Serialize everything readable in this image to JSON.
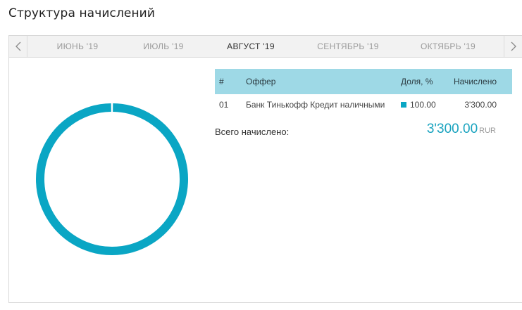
{
  "page": {
    "title": "Структура начислений"
  },
  "months": [
    {
      "label": "ИЮНЬ '19",
      "active": false
    },
    {
      "label": "ИЮЛЬ '19",
      "active": false
    },
    {
      "label": "АВГУСТ '19",
      "active": true
    },
    {
      "label": "СЕНТЯБРЬ '19",
      "active": false
    },
    {
      "label": "ОКТЯБРЬ '19",
      "active": false
    }
  ],
  "nav": {
    "prev_icon": "chevron-left-icon",
    "next_icon": "chevron-right-icon"
  },
  "table": {
    "headers": {
      "num": "#",
      "offer": "Оффер",
      "share": "Доля, %",
      "accrued": "Начислено"
    },
    "rows": [
      {
        "num": "01",
        "offer": "Банк Тинькофф Кредит наличными",
        "share": "100.00",
        "accrued": "3'300.00",
        "color": "#0aa6c4"
      }
    ]
  },
  "total": {
    "label": "Всего начислено:",
    "amount": "3'300.00",
    "currency": "RUR"
  },
  "chart_data": {
    "type": "pie",
    "categories": [
      "Банк Тинькофф Кредит наличными"
    ],
    "values": [
      100.0
    ],
    "colors": [
      "#0aa6c4"
    ]
  },
  "colors": {
    "accent": "#0aa6c4",
    "header_bg": "#9ed9e6",
    "total_value": "#19a3bf"
  }
}
